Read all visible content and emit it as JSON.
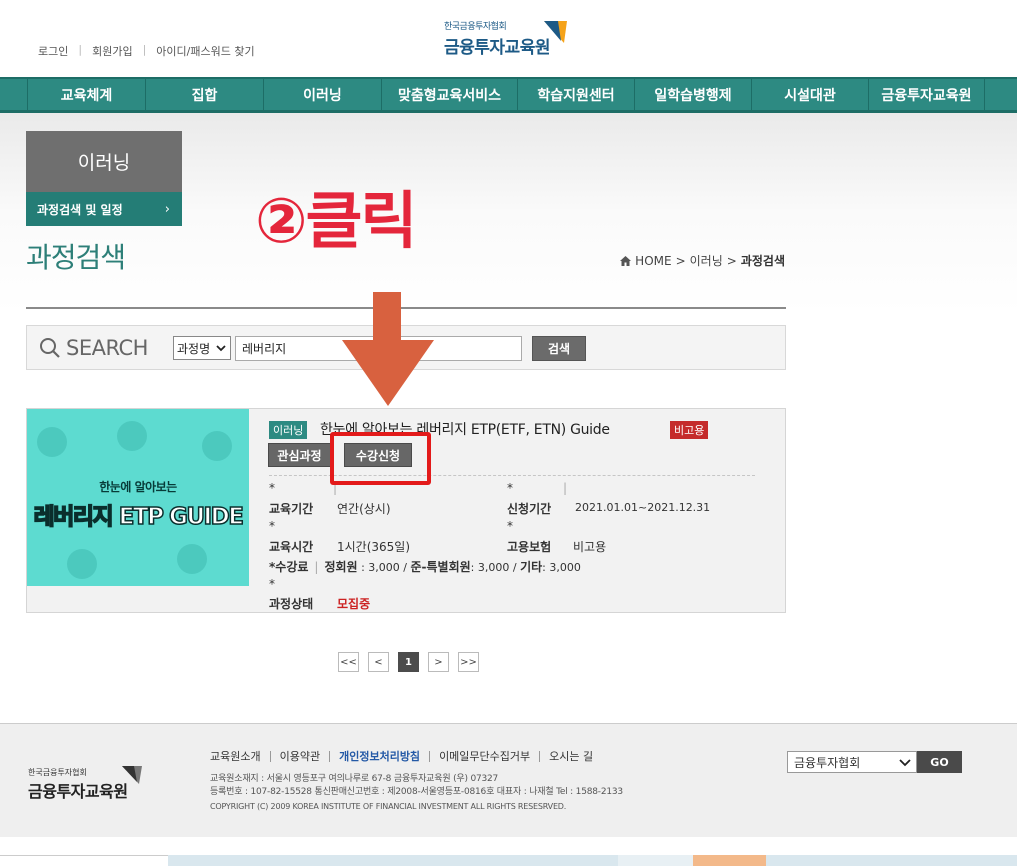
{
  "header": {
    "util_links": [
      "로그인",
      "회원가입",
      "아이디/패스워드 찾기"
    ],
    "logo_small": "한국금융투자협회",
    "logo_big": "금융투자교육원"
  },
  "gnb": {
    "items": [
      "교육체계",
      "집합",
      "이러닝",
      "맞춤형교육서비스",
      "학습지원센터",
      "일학습병행제",
      "시설대관",
      "금융투자교육원"
    ]
  },
  "lnb": {
    "title": "이러닝",
    "item": "과정검색 및 일정",
    "chevron": "›"
  },
  "page": {
    "title": "과정검색",
    "breadcrumb": [
      "HOME",
      "이러닝",
      "과정검색"
    ]
  },
  "search": {
    "label": "SEARCH",
    "select_value": "과정명",
    "input_value": "레버리지",
    "button": "검색"
  },
  "course": {
    "thumb_line1": "한눈에 알아보는",
    "thumb_line2": "레버리지 ETP GUIDE",
    "type_tag": "이러닝",
    "title": "한눈에 알아보는 레버리지 ETP(ETF, ETN) Guide",
    "insurance_tag": "비고용",
    "btn_interest": "관심과정",
    "btn_apply": "수강신청",
    "star": "*",
    "period_label": "교육기간",
    "period_value": "연간(상시)",
    "apply_label": "신청기간",
    "apply_value": "2021.01.01~2021.12.31",
    "time_label": "교육시간",
    "time_value": "1시간(365일)",
    "emp_label": "고용보험",
    "emp_value": "비고용",
    "fee_label": "*수강료",
    "fee_parts": [
      "정회원",
      " : 3,000 / ",
      "준-특별회원",
      ": 3,000 / ",
      "기타",
      ": 3,000"
    ],
    "status_label": "과정상태",
    "status_value": "모집중"
  },
  "annotation": {
    "text": "②클릭",
    "color": "#e4263b"
  },
  "pagination": {
    "first": "<<",
    "prev": "<",
    "current": "1",
    "next": ">",
    "last": ">>"
  },
  "footer": {
    "logo_small": "한국금융투자협회",
    "logo_big": "금융투자교육원",
    "links": [
      "교육원소개",
      "이용약관",
      "개인정보처리방침",
      "이메일무단수집거부",
      "오시는 길"
    ],
    "addr1": "교육원소재지 : 서울시 영등포구 여의나루로 67-8 금융투자교육원 (우) 07327",
    "addr2": "등록번호 : 107-82-15528 통신판매신고번호 : 제2008-서울영등포-0816호 대표자 : 나재철 Tel : 1588-2133",
    "copyright": "COPYRIGHT (C) 2009 KOREA INSTITUTE OF FINANCIAL INVESTMENT ALL RIGHTS RESESRVED.",
    "select_value": "금융투자협회",
    "go": "GO"
  },
  "colors": {
    "brand_teal": "#2d8a82",
    "annotation_red": "#e4263b",
    "status_red": "#c22222"
  }
}
